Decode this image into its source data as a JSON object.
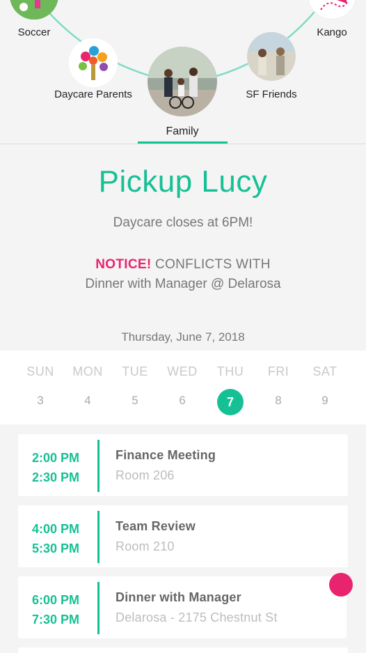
{
  "groups": {
    "items": [
      {
        "label": "Soccer",
        "icon": "soccer-photo"
      },
      {
        "label": "Kango",
        "icon": "kango-logo"
      },
      {
        "label": "Daycare Parents",
        "icon": "handprint-tree-logo"
      },
      {
        "label": "Family",
        "icon": "family-bike-photo",
        "active": true
      },
      {
        "label": "SF Friends",
        "icon": "friends-photo"
      }
    ],
    "accent": "#12c293"
  },
  "event": {
    "title": "Pickup Lucy",
    "subtitle": "Daycare closes at 6PM!",
    "notice_word": "NOTICE!",
    "notice_text": " CONFLICTS WITH",
    "conflict_with": "Dinner with Manager @ Delarosa",
    "date": "Thursday, June 7, 2018"
  },
  "week": {
    "days": [
      {
        "name": "SUN",
        "num": "3"
      },
      {
        "name": "MON",
        "num": "4"
      },
      {
        "name": "TUE",
        "num": "5"
      },
      {
        "name": "WED",
        "num": "6"
      },
      {
        "name": "THU",
        "num": "7",
        "selected": true
      },
      {
        "name": "FRI",
        "num": "8"
      },
      {
        "name": "SAT",
        "num": "9"
      }
    ]
  },
  "events": [
    {
      "start": "2:00 PM",
      "end": "2:30 PM",
      "title": "Finance Meeting",
      "location": "Room 206"
    },
    {
      "start": "4:00 PM",
      "end": "5:30 PM",
      "title": "Team Review",
      "location": "Room 210"
    },
    {
      "start": "6:00 PM",
      "end": "7:30 PM",
      "title": "Dinner with Manager",
      "location": "Delarosa - 2175 Chestnut St"
    }
  ],
  "colors": {
    "green": "#16c095",
    "pink": "#e8246e"
  }
}
